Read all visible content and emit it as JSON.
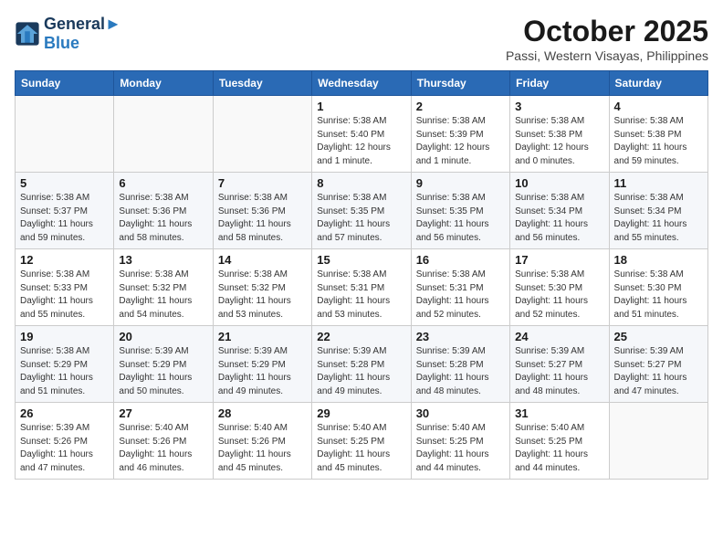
{
  "logo": {
    "line1": "General",
    "line2": "Blue"
  },
  "title": "October 2025",
  "subtitle": "Passi, Western Visayas, Philippines",
  "weekdays": [
    "Sunday",
    "Monday",
    "Tuesday",
    "Wednesday",
    "Thursday",
    "Friday",
    "Saturday"
  ],
  "weeks": [
    [
      {
        "day": "",
        "info": ""
      },
      {
        "day": "",
        "info": ""
      },
      {
        "day": "",
        "info": ""
      },
      {
        "day": "1",
        "info": "Sunrise: 5:38 AM\nSunset: 5:40 PM\nDaylight: 12 hours\nand 1 minute."
      },
      {
        "day": "2",
        "info": "Sunrise: 5:38 AM\nSunset: 5:39 PM\nDaylight: 12 hours\nand 1 minute."
      },
      {
        "day": "3",
        "info": "Sunrise: 5:38 AM\nSunset: 5:38 PM\nDaylight: 12 hours\nand 0 minutes."
      },
      {
        "day": "4",
        "info": "Sunrise: 5:38 AM\nSunset: 5:38 PM\nDaylight: 11 hours\nand 59 minutes."
      }
    ],
    [
      {
        "day": "5",
        "info": "Sunrise: 5:38 AM\nSunset: 5:37 PM\nDaylight: 11 hours\nand 59 minutes."
      },
      {
        "day": "6",
        "info": "Sunrise: 5:38 AM\nSunset: 5:36 PM\nDaylight: 11 hours\nand 58 minutes."
      },
      {
        "day": "7",
        "info": "Sunrise: 5:38 AM\nSunset: 5:36 PM\nDaylight: 11 hours\nand 58 minutes."
      },
      {
        "day": "8",
        "info": "Sunrise: 5:38 AM\nSunset: 5:35 PM\nDaylight: 11 hours\nand 57 minutes."
      },
      {
        "day": "9",
        "info": "Sunrise: 5:38 AM\nSunset: 5:35 PM\nDaylight: 11 hours\nand 56 minutes."
      },
      {
        "day": "10",
        "info": "Sunrise: 5:38 AM\nSunset: 5:34 PM\nDaylight: 11 hours\nand 56 minutes."
      },
      {
        "day": "11",
        "info": "Sunrise: 5:38 AM\nSunset: 5:34 PM\nDaylight: 11 hours\nand 55 minutes."
      }
    ],
    [
      {
        "day": "12",
        "info": "Sunrise: 5:38 AM\nSunset: 5:33 PM\nDaylight: 11 hours\nand 55 minutes."
      },
      {
        "day": "13",
        "info": "Sunrise: 5:38 AM\nSunset: 5:32 PM\nDaylight: 11 hours\nand 54 minutes."
      },
      {
        "day": "14",
        "info": "Sunrise: 5:38 AM\nSunset: 5:32 PM\nDaylight: 11 hours\nand 53 minutes."
      },
      {
        "day": "15",
        "info": "Sunrise: 5:38 AM\nSunset: 5:31 PM\nDaylight: 11 hours\nand 53 minutes."
      },
      {
        "day": "16",
        "info": "Sunrise: 5:38 AM\nSunset: 5:31 PM\nDaylight: 11 hours\nand 52 minutes."
      },
      {
        "day": "17",
        "info": "Sunrise: 5:38 AM\nSunset: 5:30 PM\nDaylight: 11 hours\nand 52 minutes."
      },
      {
        "day": "18",
        "info": "Sunrise: 5:38 AM\nSunset: 5:30 PM\nDaylight: 11 hours\nand 51 minutes."
      }
    ],
    [
      {
        "day": "19",
        "info": "Sunrise: 5:38 AM\nSunset: 5:29 PM\nDaylight: 11 hours\nand 51 minutes."
      },
      {
        "day": "20",
        "info": "Sunrise: 5:39 AM\nSunset: 5:29 PM\nDaylight: 11 hours\nand 50 minutes."
      },
      {
        "day": "21",
        "info": "Sunrise: 5:39 AM\nSunset: 5:29 PM\nDaylight: 11 hours\nand 49 minutes."
      },
      {
        "day": "22",
        "info": "Sunrise: 5:39 AM\nSunset: 5:28 PM\nDaylight: 11 hours\nand 49 minutes."
      },
      {
        "day": "23",
        "info": "Sunrise: 5:39 AM\nSunset: 5:28 PM\nDaylight: 11 hours\nand 48 minutes."
      },
      {
        "day": "24",
        "info": "Sunrise: 5:39 AM\nSunset: 5:27 PM\nDaylight: 11 hours\nand 48 minutes."
      },
      {
        "day": "25",
        "info": "Sunrise: 5:39 AM\nSunset: 5:27 PM\nDaylight: 11 hours\nand 47 minutes."
      }
    ],
    [
      {
        "day": "26",
        "info": "Sunrise: 5:39 AM\nSunset: 5:26 PM\nDaylight: 11 hours\nand 47 minutes."
      },
      {
        "day": "27",
        "info": "Sunrise: 5:40 AM\nSunset: 5:26 PM\nDaylight: 11 hours\nand 46 minutes."
      },
      {
        "day": "28",
        "info": "Sunrise: 5:40 AM\nSunset: 5:26 PM\nDaylight: 11 hours\nand 45 minutes."
      },
      {
        "day": "29",
        "info": "Sunrise: 5:40 AM\nSunset: 5:25 PM\nDaylight: 11 hours\nand 45 minutes."
      },
      {
        "day": "30",
        "info": "Sunrise: 5:40 AM\nSunset: 5:25 PM\nDaylight: 11 hours\nand 44 minutes."
      },
      {
        "day": "31",
        "info": "Sunrise: 5:40 AM\nSunset: 5:25 PM\nDaylight: 11 hours\nand 44 minutes."
      },
      {
        "day": "",
        "info": ""
      }
    ]
  ]
}
